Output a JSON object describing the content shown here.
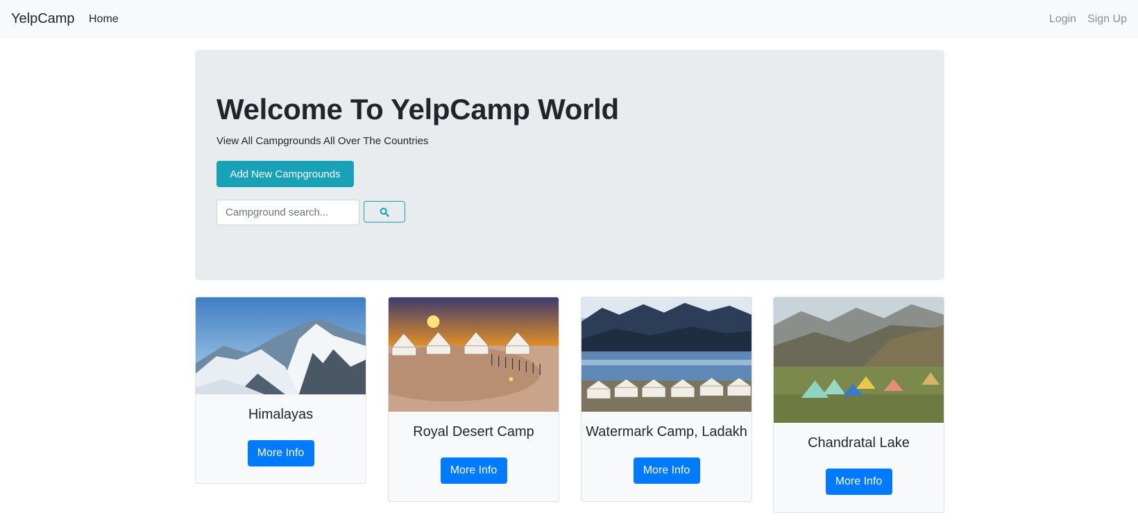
{
  "navbar": {
    "brand": "YelpCamp",
    "home": "Home",
    "login": "Login",
    "signup": "Sign Up"
  },
  "jumbotron": {
    "title": "Welcome To YelpCamp World",
    "subtitle": "View All Campgrounds All Over The Countries",
    "add_button": "Add New Campgrounds",
    "search_placeholder": "Campground search...",
    "search_icon": "search-icon"
  },
  "campgrounds": [
    {
      "name": "Himalayas",
      "button": "More Info",
      "image": "snowy-mountains-photo"
    },
    {
      "name": "Royal Desert Camp",
      "button": "More Info",
      "image": "desert-tents-sunset-photo"
    },
    {
      "name": "Watermark Camp, Ladakh",
      "button": "More Info",
      "image": "lake-tents-mountains-photo"
    },
    {
      "name": "Chandratal Lake",
      "button": "More Info",
      "image": "valley-tents-photo"
    }
  ],
  "colors": {
    "navbar_bg": "#f8f9fa",
    "jumbotron_bg": "#e9ecef",
    "accent_info": "#17a2b8",
    "primary": "#007bff"
  }
}
